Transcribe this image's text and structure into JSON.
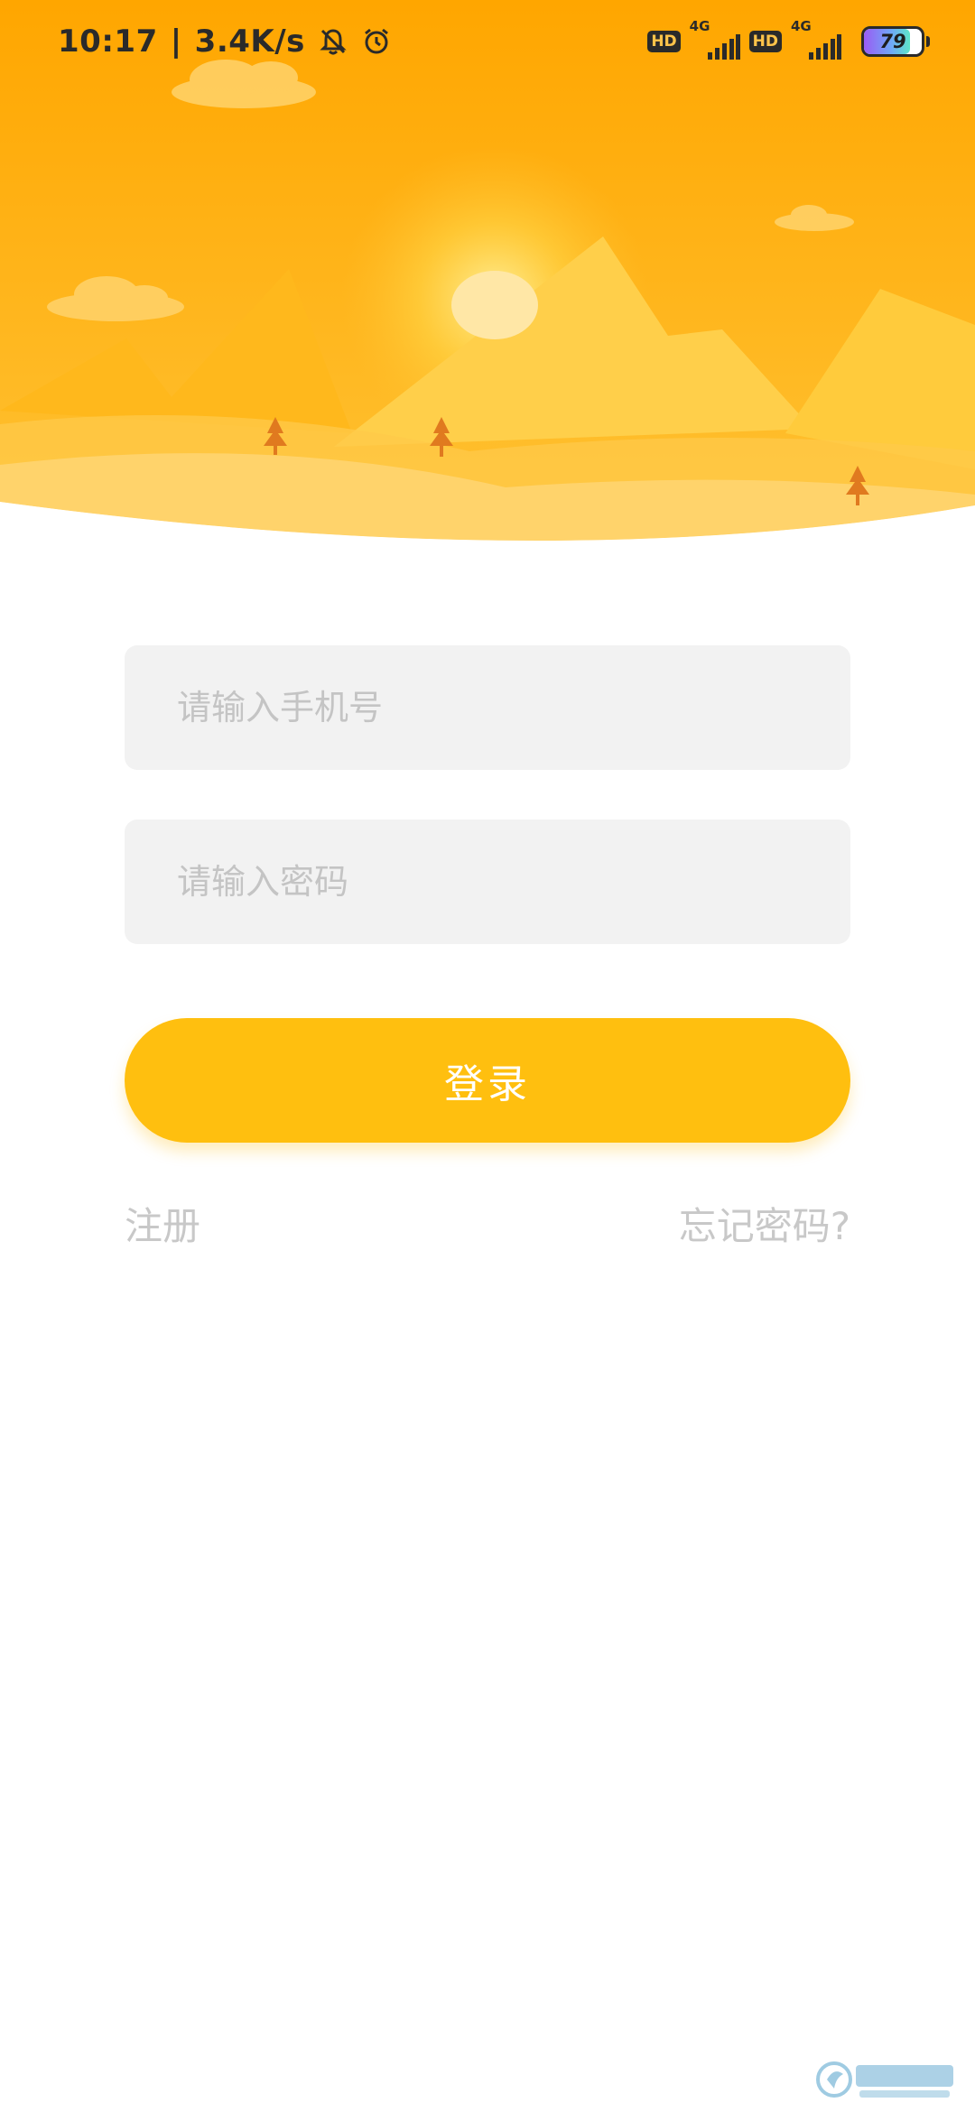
{
  "status_bar": {
    "time": "10:17",
    "separator": "|",
    "net_speed": "3.4K/s",
    "sim1": {
      "hd": "HD",
      "network": "4G"
    },
    "sim2": {
      "hd": "HD",
      "network": "4G"
    },
    "battery_level": "79",
    "icons": [
      "bell-muted-icon",
      "alarm-clock-icon",
      "signal-icon",
      "battery-icon"
    ]
  },
  "hero": {
    "description_icons": [
      "cloud-icon",
      "sun-icon",
      "mountain-icon",
      "tree-icon"
    ],
    "colors": {
      "sky_top": "#ffa600",
      "sky_bottom": "#ffbd2e",
      "mountain_light": "#ffcf4a",
      "sun": "#ffe7a6",
      "tree": "#e07a1f"
    }
  },
  "login_form": {
    "phone_placeholder": "请输入手机号",
    "password_placeholder": "请输入密码",
    "login_label": "登录",
    "register_label": "注册",
    "forgot_password_label": "忘记密码?"
  },
  "theme": {
    "accent": "#ffbf0f",
    "input_bg": "#f2f2f2",
    "placeholder": "#c4c4c4",
    "link": "#c8c8c8"
  },
  "watermark": {
    "text": "飞翔下载",
    "subtext": "www.FXXZ.com"
  }
}
